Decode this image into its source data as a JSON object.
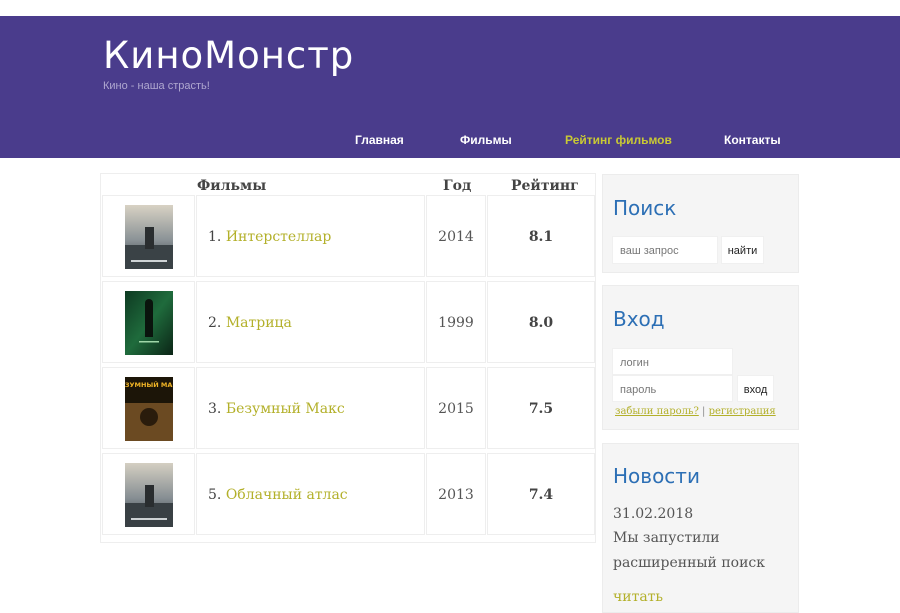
{
  "header": {
    "logo": "КиноМонстр",
    "tagline": "Кино - наша страсть!",
    "nav": [
      {
        "label": "Главная",
        "active": false
      },
      {
        "label": "Фильмы",
        "active": false
      },
      {
        "label": "Рейтинг фильмов",
        "active": true
      },
      {
        "label": "Контакты",
        "active": false
      }
    ]
  },
  "table": {
    "headers": {
      "films": "Фильмы",
      "year": "Год",
      "rating": "Рейтинг"
    },
    "rows": [
      {
        "rank": "1.",
        "title": "Интерстеллар",
        "year": "2014",
        "rating": "8.1",
        "poster_icon": "interstellar-poster-icon"
      },
      {
        "rank": "2.",
        "title": "Матрица",
        "year": "1999",
        "rating": "8.0",
        "poster_icon": "matrix-poster-icon"
      },
      {
        "rank": "3.",
        "title": "Безумный Макс",
        "year": "2015",
        "rating": "7.5",
        "poster_icon": "mad-max-poster-icon"
      },
      {
        "rank": "5.",
        "title": "Облачный атлас",
        "year": "2013",
        "rating": "7.4",
        "poster_icon": "cloud-atlas-poster-icon"
      }
    ],
    "mad_max_poster_text": "БЕЗУМНЫЙ МАКС"
  },
  "search": {
    "title": "Поиск",
    "placeholder": "ваш запрос",
    "button": "найти"
  },
  "login": {
    "title": "Вход",
    "login_placeholder": "логин",
    "password_placeholder": "пароль",
    "button": "вход",
    "forgot": "забыли пароль?",
    "separator": "|",
    "register": "регистрация"
  },
  "news": {
    "title": "Новости",
    "date": "31.02.2018",
    "text": "Мы запустили расширенный поиск",
    "read_more": "читать"
  },
  "colors": {
    "header_bg": "#4a3c8c",
    "link": "#b3b02a",
    "widget_title": "#2c6fb5"
  }
}
